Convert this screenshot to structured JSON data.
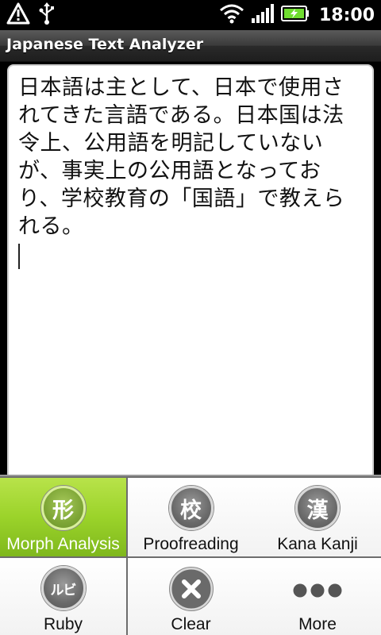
{
  "status_bar": {
    "time": "18:00",
    "icons": [
      "alert-triangle-icon",
      "usb-icon",
      "wifi-icon",
      "signal-icon",
      "battery-charging-icon"
    ]
  },
  "app": {
    "title": "Japanese Text Analyzer"
  },
  "editor": {
    "text": "日本語は主として、日本で使用されてきた言語である。日本国は法令上、公用語を明記していないが、事実上の公用語となっており、学校教育の「国語」で教えられる。"
  },
  "menu": {
    "items": [
      {
        "label": "Morph Analysis",
        "icon_glyph": "形",
        "selected": true
      },
      {
        "label": "Proofreading",
        "icon_glyph": "校",
        "selected": false
      },
      {
        "label": "Kana Kanji",
        "icon_glyph": "漢",
        "selected": false
      },
      {
        "label": "Ruby",
        "icon_glyph": "ルビ",
        "selected": false
      },
      {
        "label": "Clear",
        "icon": "close-icon",
        "selected": false
      },
      {
        "label": "More",
        "icon": "more-dots-icon",
        "selected": false
      }
    ]
  },
  "colors": {
    "selected_accent": "#9bd32a",
    "battery_charge": "#6fdc2f"
  }
}
